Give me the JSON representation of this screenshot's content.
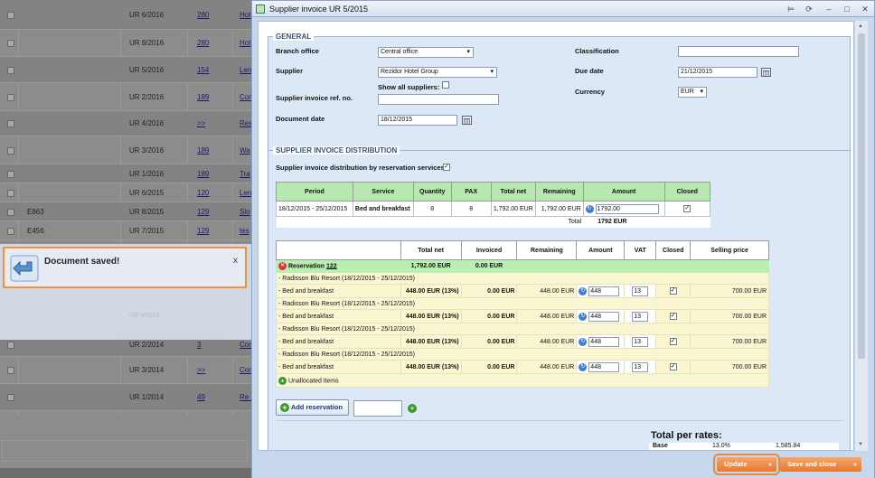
{
  "background_list": {
    "rows": [
      {
        "c1": "",
        "c2": "UR 6/2016",
        "c3": "280",
        "c4": "Hot"
      },
      {
        "c1": "",
        "c2": "UR 8/2016",
        "c3": "280",
        "c4": "Hot"
      },
      {
        "c1": "",
        "c2": "UR 5/2016",
        "c3": "154",
        "c4": "Len"
      },
      {
        "c1": "",
        "c2": "UR 2/2016",
        "c3": "189",
        "c4": "Con"
      },
      {
        "c1": "",
        "c2": "UR 4/2016",
        "c3": ">>",
        "c4": "Res Gre"
      },
      {
        "c1": "",
        "c2": "UR 3/2016",
        "c3": "189",
        "c4": "Wa"
      },
      {
        "c1": "",
        "c2": "UR 1/2016",
        "c3": "189",
        "c4": "Tra"
      },
      {
        "c1": "",
        "c2": "UR 6/2015",
        "c3": "120",
        "c4": "Len"
      },
      {
        "c1": "E863",
        "c2": "UR 8/2015",
        "c3": "129",
        "c4": "Slo"
      },
      {
        "c1": "E456",
        "c2": "UR 7/2015",
        "c3": "129",
        "c4": "tes"
      },
      {
        "c1": "",
        "c2": "UR 2/2014",
        "c3": "3",
        "c4": "Con"
      },
      {
        "c1": "",
        "c2": "UR 3/2014",
        "c3": ">>",
        "c4": "Con"
      },
      {
        "c1": "",
        "c2": "UR 1/2014",
        "c3": "49",
        "c4": "Re Gre"
      }
    ]
  },
  "toast": {
    "message": "Document saved!",
    "close": "x"
  },
  "dialog": {
    "title": "Supplier invoice UR 5/2015",
    "general": {
      "legend": "GENERAL",
      "branch_label": "Branch office",
      "branch_value": "Central office",
      "supplier_label": "Supplier",
      "supplier_value": "Rezidor Hotel Group",
      "show_all_label": "Show all suppliers:",
      "ref_label": "Supplier invoice ref. no.",
      "ref_value": "",
      "doc_date_label": "Document date",
      "doc_date_value": "18/12/2015",
      "classification_label": "Classification",
      "classification_value": "",
      "due_label": "Due date",
      "due_value": "21/12/2015",
      "currency_label": "Currency",
      "currency_value": "EUR"
    },
    "distribution": {
      "legend": "SUPPLIER INVOICE DISTRIBUTION",
      "by_res_label": "Supplier invoice distribution by reservation services",
      "headers": [
        "Period",
        "Service",
        "Quantity",
        "PAX",
        "Total net",
        "Remaining",
        "Amount",
        "Closed"
      ],
      "row": {
        "period": "18/12/2015 - 25/12/2015",
        "service": "Bed and breakfast",
        "quantity": "8",
        "pax": "8",
        "total_net": "1,792.00 EUR",
        "remaining": "1,792.00 EUR",
        "amount": "1792.00"
      },
      "total_label": "Total",
      "total_value": "1792 EUR"
    },
    "reservation_table": {
      "headers": [
        "",
        "Total net",
        "Invoiced",
        "Remaining",
        "Amount",
        "VAT",
        "Closed",
        "Selling price"
      ],
      "reservation_label": "Reservation",
      "reservation_no": "122",
      "reservation_total": "1,792.00 EUR",
      "reservation_invoiced": "0.00 EUR",
      "groups": [
        {
          "hotel": "- Radisson Blu Resort (18/12/2015 - 25/12/2015)",
          "service": "- Bed and breakfast",
          "total_net": "448.00 EUR (13%)",
          "invoiced": "0.00 EUR",
          "remaining": "448.00 EUR",
          "amount": "448",
          "vat": "13",
          "selling": "700.00 EUR"
        },
        {
          "hotel": "- Radisson Blu Resort (18/12/2015 - 25/12/2015)",
          "service": "- Bed and breakfast",
          "total_net": "448.00 EUR (13%)",
          "invoiced": "0.00 EUR",
          "remaining": "448.00 EUR",
          "amount": "448",
          "vat": "13",
          "selling": "700.00 EUR"
        },
        {
          "hotel": "- Radisson Blu Resort (18/12/2015 - 25/12/2015)",
          "service": "- Bed and breakfast",
          "total_net": "448.00 EUR (13%)",
          "invoiced": "0.00 EUR",
          "remaining": "448.00 EUR",
          "amount": "448",
          "vat": "13",
          "selling": "700.00 EUR"
        },
        {
          "hotel": "- Radisson Blu Resort (18/12/2015 - 25/12/2015)",
          "service": "- Bed and breakfast",
          "total_net": "448.00 EUR (13%)",
          "invoiced": "0.00 EUR",
          "remaining": "448.00 EUR",
          "amount": "448",
          "vat": "13",
          "selling": "700.00 EUR"
        }
      ],
      "unallocated_label": "Unallocated items"
    },
    "add_reservation_label": "Add reservation",
    "totals": {
      "title": "Total per rates:",
      "base_label": "Base",
      "base_pct": "13.0%",
      "base_value": "1,585.84"
    },
    "footer": {
      "update_label": "Update",
      "save_close_label": "Save and close"
    }
  },
  "colors": {
    "accent": "#f0923a",
    "header_green": "#b7e8b0",
    "res_green": "#b9efb0",
    "hotel_yellow": "#fbf6d2"
  }
}
